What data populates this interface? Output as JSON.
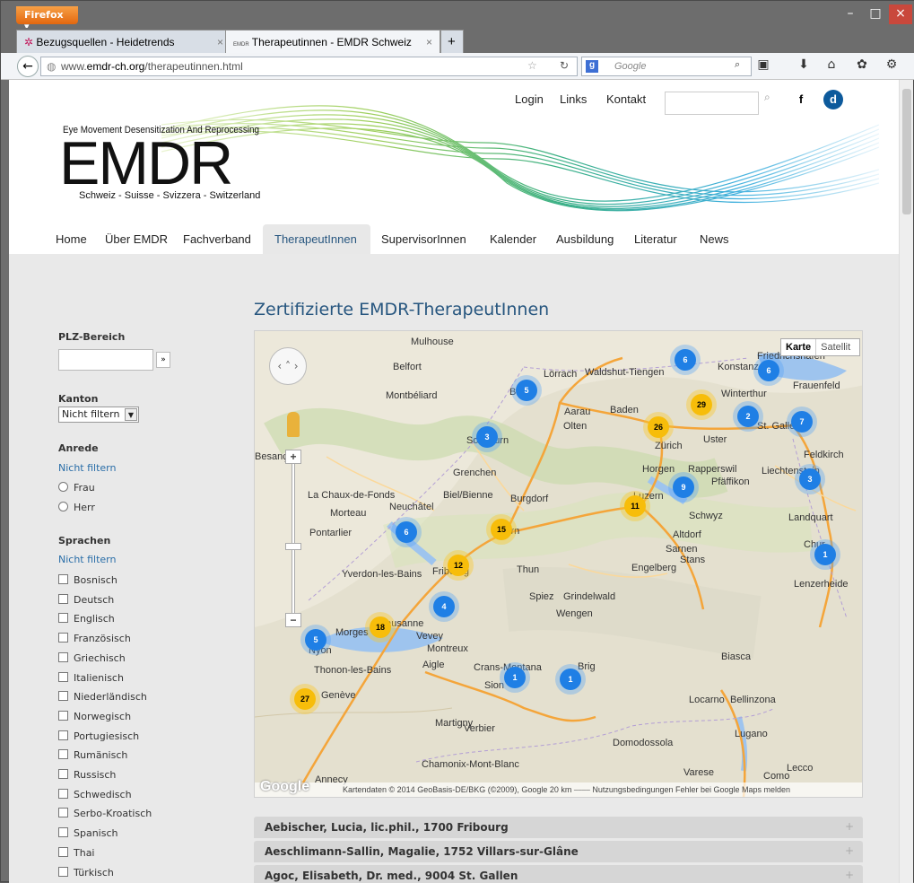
{
  "browser": {
    "app_button": "Firefox ▾",
    "tabs": [
      {
        "label": "Bezugsquellen - Heidetrends"
      },
      {
        "label": "Therapeutinnen - EMDR Schweiz",
        "favicon": "EMDR"
      }
    ],
    "url_prefix": "www.",
    "url_domain": "emdr-ch.org",
    "url_path": "/therapeutinnen.html",
    "search_placeholder": "Google",
    "new_tab": "+"
  },
  "header": {
    "logo_tagline": "Eye Movement Desensitization And Reprocessing",
    "logo_text": "EMDR",
    "logo_languages": "Schweiz - Suisse - Svizzera - Switzerland",
    "top_links": [
      "Login",
      "Links",
      "Kontakt"
    ],
    "facebook": "f",
    "d_icon": "d"
  },
  "menu": [
    "Home",
    "Über EMDR",
    "Fachverband",
    "TherapeutInnen",
    "SupervisorInnen",
    "Kalender",
    "Ausbildung",
    "Literatur",
    "News"
  ],
  "page_title": "Zertifizierte EMDR-TherapeutInnen",
  "sidebar": {
    "plz_heading": "PLZ-Bereich",
    "plz_go": "»",
    "kanton_heading": "Kanton",
    "kanton_value": "Nicht filtern",
    "anrede_heading": "Anrede",
    "anrede_nofilter": "Nicht filtern",
    "anrede_options": [
      "Frau",
      "Herr"
    ],
    "sprachen_heading": "Sprachen",
    "sprachen_nofilter": "Nicht filtern",
    "languages": [
      "Bosnisch",
      "Deutsch",
      "Englisch",
      "Französisch",
      "Griechisch",
      "Italienisch",
      "Niederländisch",
      "Norwegisch",
      "Portugiesisch",
      "Rumänisch",
      "Russisch",
      "Schwedisch",
      "Serbo-Kroatisch",
      "Spanisch",
      "Thai",
      "Türkisch"
    ]
  },
  "map": {
    "type_buttons": [
      "Karte",
      "Satellit"
    ],
    "attribution": "Kartendaten © 2014 GeoBasis-DE/BKG (©2009), Google   20 km ⎯⎯⎯⎯   Nutzungsbedingungen   Fehler bei Google Maps melden",
    "google_logo": "Google",
    "places": [
      "Mulhouse",
      "Belfort",
      "Lörrach",
      "Basel",
      "Montbéliard",
      "Waldshut-Tiengen",
      "Konstanz",
      "Friedrichshafen",
      "Frauenfeld",
      "Winterthur",
      "Baden",
      "Aarau",
      "Olten",
      "Zürich",
      "Uster",
      "St. Gallen",
      "Solothurn",
      "Grenchen",
      "Besançon",
      "Horgen",
      "Rapperswil",
      "Pfäffikon",
      "Liechtenstein",
      "Feldkirch",
      "La Chaux-de-Fonds",
      "Biel/Bienne",
      "Burgdorf",
      "Luzern",
      "Morteau",
      "Neuchâtel",
      "Pontarlier",
      "Bern",
      "Schwyz",
      "Landquart",
      "Stans",
      "Altdorf",
      "Sarnen",
      "Yverdon-les-Bains",
      "Fribourg",
      "Thun",
      "Engelberg",
      "Chur",
      "Spiez",
      "Grindelwald",
      "Wengen",
      "Lausanne",
      "Vevey",
      "Montreux",
      "Morges",
      "Nyon",
      "Aigle",
      "Crans-Montana",
      "Sion",
      "Brig",
      "Biasca",
      "Locarno",
      "Bellinzona",
      "Genève",
      "Thonon-les-Bains",
      "Martigny",
      "Verbier",
      "Domodossola",
      "Lugano",
      "Annecy",
      "Chamonix-Mont-Blanc",
      "Como",
      "Lecco",
      "Varese",
      "Lenzerheide"
    ],
    "clusters": [
      {
        "n": "5",
        "c": "blue"
      },
      {
        "n": "6",
        "c": "blue"
      },
      {
        "n": "6",
        "c": "blue"
      },
      {
        "n": "29",
        "c": "yellow"
      },
      {
        "n": "2",
        "c": "blue"
      },
      {
        "n": "7",
        "c": "blue"
      },
      {
        "n": "3",
        "c": "blue"
      },
      {
        "n": "26",
        "c": "yellow"
      },
      {
        "n": "9",
        "c": "blue"
      },
      {
        "n": "3",
        "c": "blue"
      },
      {
        "n": "11",
        "c": "yellow"
      },
      {
        "n": "6",
        "c": "blue"
      },
      {
        "n": "15",
        "c": "yellow"
      },
      {
        "n": "12",
        "c": "yellow"
      },
      {
        "n": "1",
        "c": "blue"
      },
      {
        "n": "4",
        "c": "blue"
      },
      {
        "n": "18",
        "c": "yellow"
      },
      {
        "n": "5",
        "c": "blue"
      },
      {
        "n": "1",
        "c": "blue"
      },
      {
        "n": "1",
        "c": "blue"
      },
      {
        "n": "27",
        "c": "yellow"
      }
    ]
  },
  "entries": [
    "Aebischer, Lucia, lic.phil., 1700 Fribourg",
    "Aeschlimann-Sallin, Magalie, 1752 Villars-sur-Glâne",
    "Agoc, Elisabeth, Dr. med., 9004 St. Gallen"
  ],
  "entry_expand": "+",
  "colors": {
    "accent": "#27567f",
    "link": "#2a6ea8",
    "cluster_blue": "#1f7fe5",
    "cluster_yellow": "#f7bd0a",
    "firefox_orange": "#e2670f"
  }
}
